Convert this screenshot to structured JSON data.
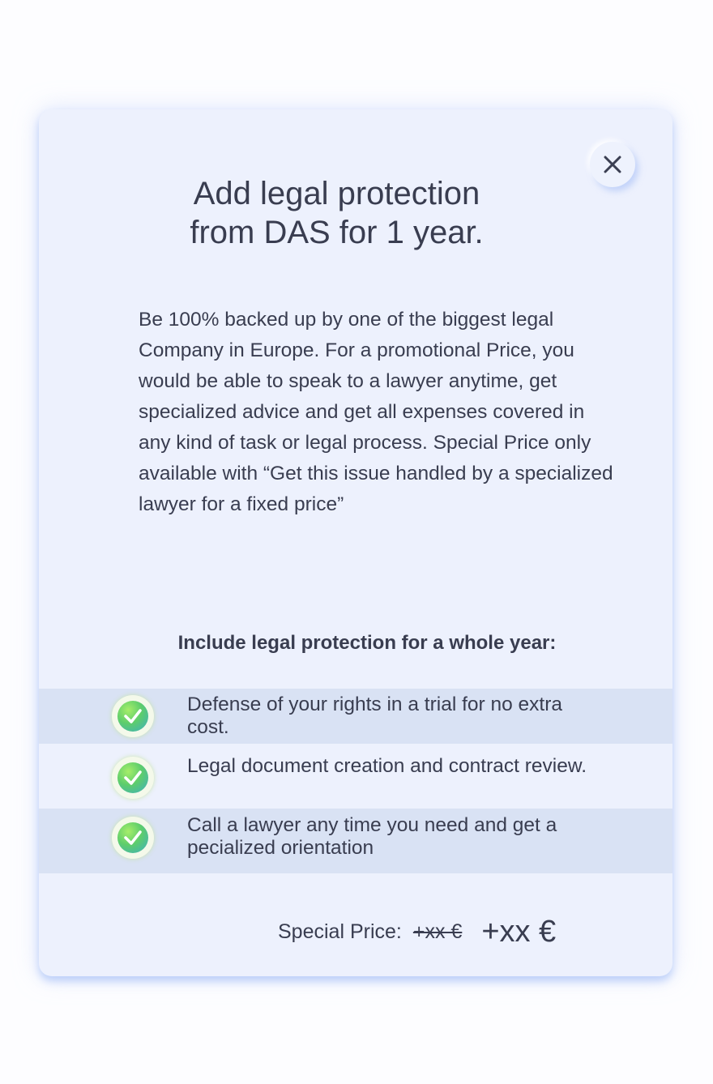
{
  "dialog": {
    "close_label": "×",
    "title_line1": "Add legal protection",
    "title_line2": "from DAS for 1 year.",
    "description": "Be 100% backed up by one of the biggest legal Company in Europe. For a promotional Price, you would be able to speak to a lawyer anytime, get specialized advice and get all expenses covered in any kind of task or legal process. Special Price only available with “Get this issue handled by a specialized lawyer for a fixed price”",
    "includes_heading": "Include legal protection for a whole year:",
    "features": [
      {
        "text": "Defense of your rights in a trial for no extra cost.",
        "icon": "check-circle-icon"
      },
      {
        "text": "Legal document creation and contract review.",
        "icon": "check-circle-icon"
      },
      {
        "text": "Call a lawyer any time you need and get a pecialized orientation",
        "icon": "check-circle-icon"
      }
    ],
    "price": {
      "label": "Special Price:",
      "old": "+xx €",
      "new": "+xx €"
    }
  },
  "colors": {
    "modal_background": "#edf1fd",
    "shaded_row": "#d9e2f4",
    "text": "#393d50",
    "check_green": "#5ecd6b",
    "check_teal": "#3dafc1"
  }
}
